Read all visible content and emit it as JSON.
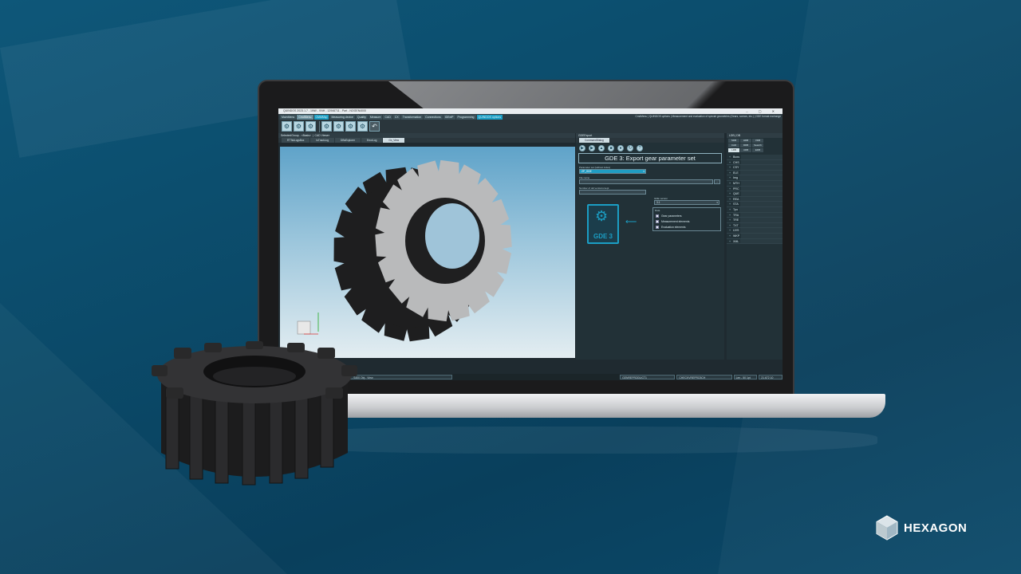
{
  "app": {
    "window_title": "QUINDOS 2023.1.7 - 1NW - VNH - 12946711 - Part - NOGEN4000",
    "window_buttons": [
      "–",
      "▢",
      "✕"
    ],
    "menu_right_text": "CmdMenu | QUINDOS options | Measurement and evaluation of special geometries (Gears, screws, etc.) | GDE format exchange"
  },
  "menu": {
    "items": [
      "MainMenu",
      "CmdMenu",
      "CMMMsp",
      "Measuring device",
      "Quality",
      "Measure",
      "CAD",
      "CX",
      "Transformation",
      "Connections",
      "IDExtP",
      "Programming",
      "QUINDOS options"
    ]
  },
  "viewport_panel": {
    "title": "SelectedGroup - <Basis>",
    "title2": "CAD Viewer",
    "tabs": [
      "RTTskLogsBox",
      "IsTrackLog",
      "DBsExplorer",
      "ErrorLog",
      "Gx_View"
    ]
  },
  "command_panel": {
    "title": "GDEExport",
    "tab": "CommandDialog",
    "heading": "GDE 3: Export gear parameter set",
    "param_label": "Parameter set (without index)",
    "param_value": "ZP_GDE",
    "file_label": "File name",
    "file_value": "",
    "file_button": "...",
    "old_versions_label": "Number of old versions kept",
    "version_label": "GDE version",
    "version_value": "3.1",
    "data_label": "Data",
    "checks": [
      "Gear parameters",
      "Measurement elements",
      "Evaluation elements"
    ],
    "gde_icon_label": "GDE 3"
  },
  "right_panel": {
    "title": "LDB",
    "title2": "DB",
    "tabs_row1": [
      "SDB",
      "HDB",
      "VDB"
    ],
    "tabs_row2": [
      "CAD",
      "RDB",
      "Search"
    ],
    "tabs_row3": [
      "LDB",
      "UDB",
      "EDB"
    ],
    "tree_items": [
      "Boxs",
      "CHS",
      "CSY",
      "ELE",
      "Img",
      "MTH",
      "PRC",
      "QUE",
      "REA",
      "STA",
      "Tpx",
      "TRA",
      "TRE",
      "TXT",
      "UVS",
      "WKP",
      "XML"
    ]
  },
  "status": {
    "left": "GenStirnGear ST1 - S400 Obj - View",
    "mid1": "GENREPRODUCT1",
    "mid2": "CHECKVREPRO3CH",
    "units": "Len - 50 1pt",
    "coord": "21.672 10"
  },
  "brand": {
    "name": "HEXAGON"
  },
  "colors": {
    "background": "#0b4a69",
    "accent": "#1b9ec4",
    "gear_light": "#b9babb",
    "gear_dark": "#1e1e1f"
  }
}
